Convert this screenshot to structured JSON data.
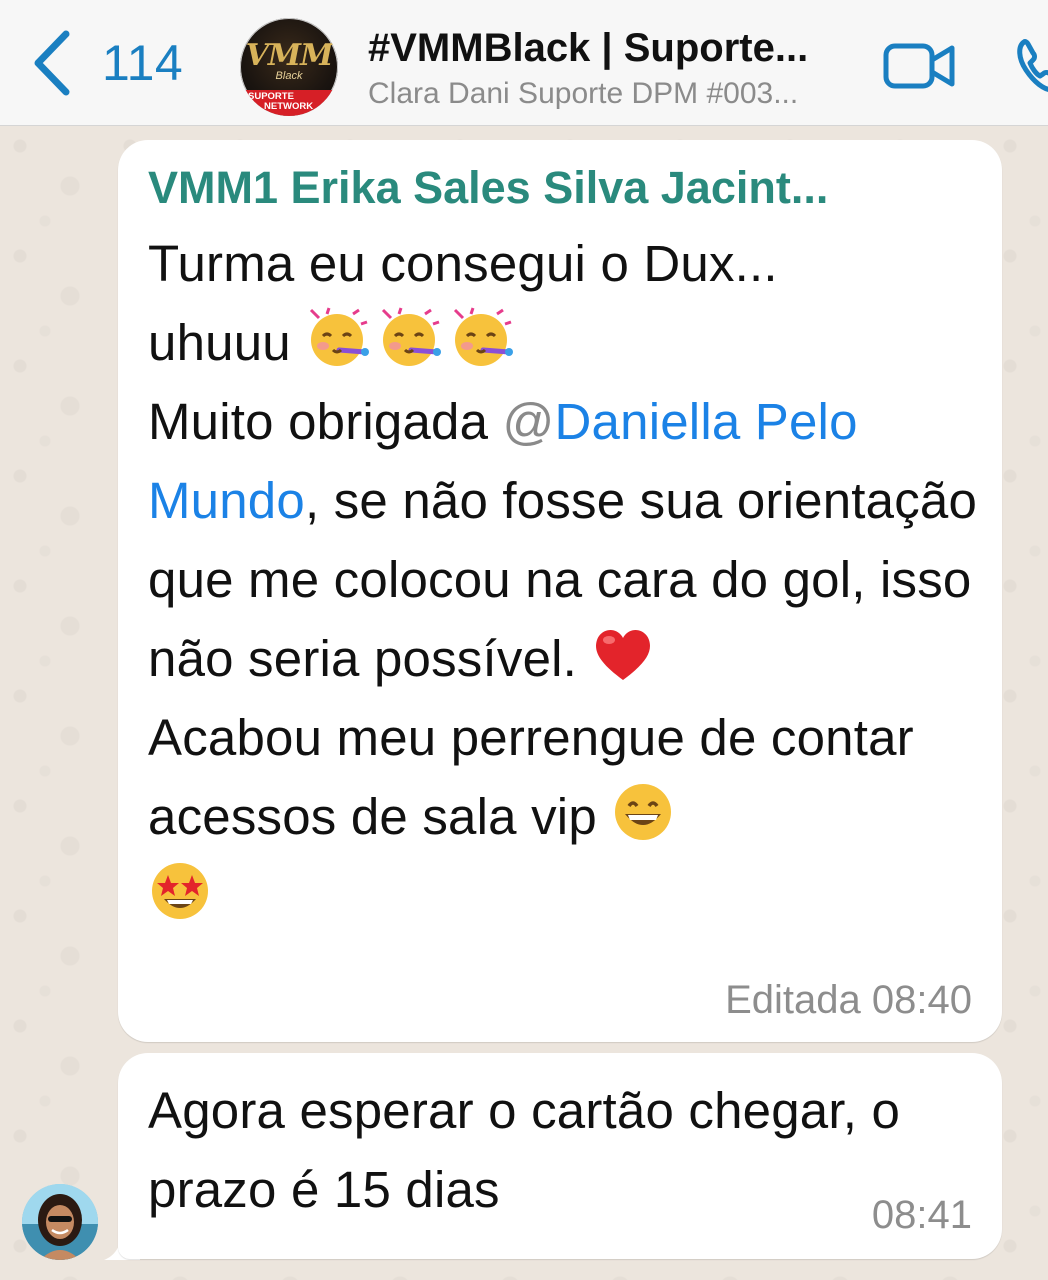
{
  "header": {
    "back_count": "114",
    "group_name": "#VMMBlack | Suporte...",
    "group_subtitle": "Clara Dani Suporte DPM #003...",
    "avatar_logo": "VMM",
    "avatar_logo_sub": "Black",
    "avatar_band_line1": "SUPORTE",
    "avatar_band_line2": "NETWORK"
  },
  "messages": [
    {
      "sender": "VMM1 Erika Sales Silva Jacint...",
      "line1": "Turma eu consegui o Dux...",
      "line2": "uhuuu",
      "line3_prefix": "Muito obrigada ",
      "mention_at": "@",
      "mention_name": "Daniella Pelo Mundo",
      "line3_suffix": ", se não fosse sua orientação que me colocou na cara do gol, isso não seria possível.",
      "line4": "Acabou meu perrengue de contar acessos de sala vip",
      "edited_label": "Editada",
      "time": "08:40"
    },
    {
      "text": "Agora esperar o cartão chegar, o prazo é 15 dias",
      "time": "08:41"
    }
  ],
  "icons": {
    "back": "chevron-left-icon",
    "video": "video-camera-icon",
    "phone": "phone-icon",
    "party": "partying-face-emoji",
    "heart": "red-heart-emoji",
    "grin": "grinning-face-emoji",
    "star_struck": "star-struck-emoji"
  },
  "colors": {
    "accent": "#1a7fc1",
    "sender_name": "#2a8a7d",
    "mention": "#1b82e6",
    "bubble": "#ffffff",
    "chat_bg": "#ece5dd"
  }
}
